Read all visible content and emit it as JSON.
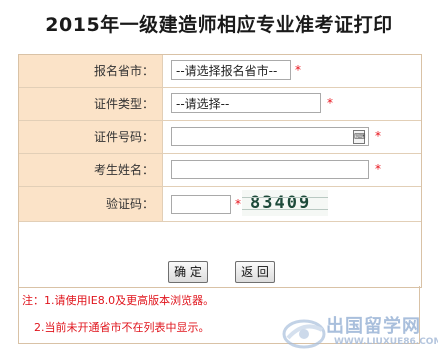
{
  "page": {
    "title": "2015年一级建造师相应专业准考证打印"
  },
  "form": {
    "province": {
      "label": "报名省市：",
      "selected": "--请选择报名省市--",
      "required": "*"
    },
    "cert_type": {
      "label": "证件类型：",
      "selected": "--请选择--",
      "required": "*"
    },
    "cert_no": {
      "label": "证件号码：",
      "value": "",
      "required": "*"
    },
    "name": {
      "label": "考生姓名：",
      "value": "",
      "required": "*"
    },
    "captcha": {
      "label": "验证码：",
      "value": "",
      "required": "*",
      "image_text": "83409"
    }
  },
  "buttons": {
    "confirm": "确 定",
    "back": "返 回"
  },
  "notes": {
    "line1": "注：1.请使用IE8.0及更高版本浏览器。",
    "line2": "2.当前未开通省市不在列表中显示。"
  },
  "watermark": {
    "name": "出国留学网",
    "url": "WWW.LIUXUE86.COM"
  }
}
